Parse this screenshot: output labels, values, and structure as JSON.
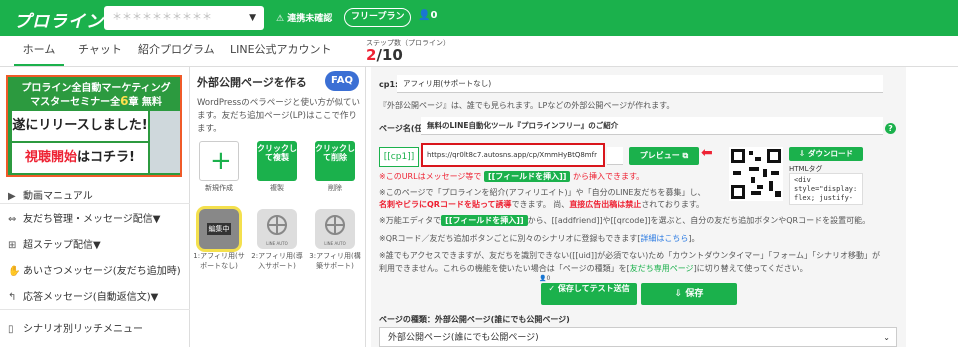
{
  "header": {
    "logo": "プロライン",
    "account_name": "＊＊＊＊＊＊＊＊＊＊",
    "caret": "▼",
    "warning": "連携未確認",
    "plan": "フリープラン",
    "user_count": "0"
  },
  "nav": {
    "tabs": [
      {
        "label": "ホーム"
      },
      {
        "label": "チャット"
      },
      {
        "label": "紹介プログラム"
      },
      {
        "label": "LINE公式アカウント"
      }
    ],
    "steps_label": "ステップ数（プロライン）",
    "steps_current": "2",
    "steps_total": "/10"
  },
  "banner": {
    "line1": "プロライン全自動マーケティング",
    "line2": "マスターセミナー全",
    "line2_count": "6",
    "line2_tail": "章 無料",
    "line3": "遂にリリースしました!",
    "line4a": "視聴開始",
    "line4b": "はコチラ!"
  },
  "sidebar": {
    "items": [
      {
        "label": "動画マニュアル",
        "icon": "▶"
      },
      {
        "label": "友だち管理・メッセージ配信▼",
        "icon": "⇔"
      },
      {
        "label": "超ステップ配信▼",
        "icon": "⊞"
      },
      {
        "label": "あいさつメッセージ(友だち追加時)",
        "icon": "✋"
      },
      {
        "label": "応答メッセージ(自動返信文)▼",
        "icon": "↰"
      },
      {
        "label": "シナリオ別リッチメニュー",
        "icon": "▯"
      },
      {
        "label": "",
        "icon": ""
      }
    ]
  },
  "pages": {
    "title": "外部公開ページを作る",
    "faq": "FAQ",
    "desc": "WordPressのペラページと使い方が似ています。友だち追加ページ(LP)はここで作ります。",
    "new_label": "新規作成",
    "copy_btn": "クリックして複製",
    "copy_label": "複製",
    "del_btn": "クリックして削除",
    "del_label": "削除",
    "editing": "編集中",
    "templates": [
      {
        "label": "1:アフィリ用(サポートなし)",
        "tiny": ""
      },
      {
        "label": "2:アフィリ用(導入サポート)",
        "tiny": "LINE AUTO"
      },
      {
        "label": "3:アフィリ用(構築サポート)",
        "tiny": "LINE AUTO"
      }
    ]
  },
  "main": {
    "cp_label": "cp1:",
    "cp_value": "アフィリ用(サポートなし)",
    "notice": "『外部公開ページ』は、誰でも見られます。LPなどの外部公開ページが作れます。",
    "page_name_label": "ページ名(任意)",
    "page_name_value": "無料のLINE自動化ツール『プロラインフリー』のご紹介",
    "help": "?",
    "tag": "[[cp1]]",
    "url": "https://qr0lt8c7.autosns.app/cp/XmmHyBtQ8mfr",
    "preview": "プレビュー",
    "arrow": "⬅",
    "download": "ダウンロード",
    "html_tag_label": "HTMLタグ",
    "html_tag_value": "<div style=\"display: flex; justify-",
    "note1_a": "※このURLはメッセージ等で",
    "note1_pill": "[[フィールドを挿入]]",
    "note1_b": "から挿入できます。",
    "note2": "※このページで「プロラインを紹介(アフィリエイト)」や「自分のLINE友だちを募集」し、",
    "note3_red": "名刺やビラにQRコードを貼って誘導",
    "note3_b": "できます。 尚、",
    "note3_red2": "直接広告出稿は禁止",
    "note3_c": "されております。",
    "note4_a": "※万能エディタで",
    "note4_pill": "[[フィールドを挿入]]",
    "note4_b": "から、[[addfriend]]や[[qrcode]]を選ぶと、自分の友だち追加ボタンやQRコードを設置可能。",
    "note5_a": "※QRコード／友だち追加ボタンごとに別々のシナリオに登録もできます[",
    "note5_link": "詳細はこちら",
    "note5_b": "]。",
    "note6": "※誰でもアクセスできますが、友だちを識別できない([[uid]]が必須でない)ため「カウントダウンタイマー」「フォーム」「シナリオ移動」が",
    "note7_a": "利用できません。これらの機能を使いたい場合は「ページの種類」を[",
    "note7_green": "友だち専用ページ",
    "note7_b": "]に切り替えて使ってください。",
    "save_count": "0",
    "save_test": "保存してテスト送信",
    "save": "保存",
    "page_type_label": "ページの種類：外部公開ページ(誰にでも公開ページ)",
    "page_type_value": "外部公開ページ(誰にでも公開ページ)"
  },
  "colors": {
    "brand": "#1bb14c",
    "accent_red": "#e23",
    "faq_blue": "#3b6fd4"
  }
}
